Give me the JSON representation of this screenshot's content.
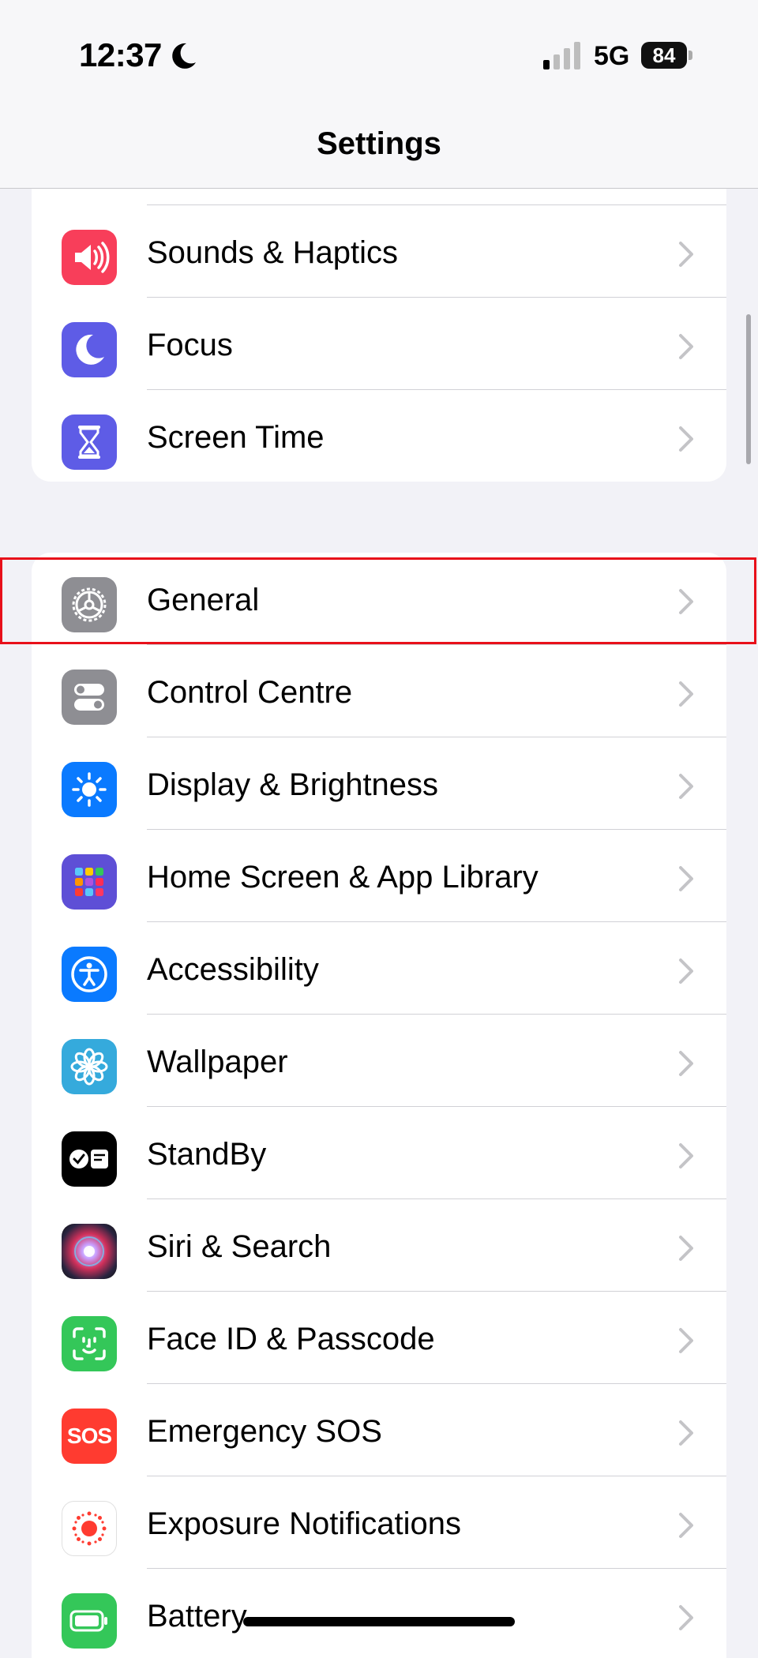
{
  "status": {
    "time": "12:37",
    "network": "5G",
    "battery": "84"
  },
  "nav": {
    "title": "Settings"
  },
  "colors": {
    "sounds": "#f83e5a",
    "focus": "#5e5ce6",
    "screentime": "#5e5ce6",
    "general": "#8e8e93",
    "control": "#8e8e93",
    "display": "#0a7aff",
    "home": "#5e4fd6",
    "accessibility": "#0a7aff",
    "wallpaper": "#35aadc",
    "standby": "#000000",
    "faceid": "#34c759",
    "sos": "#ff3b30",
    "battery": "#34c759",
    "highlight": "#e8101a"
  },
  "groups": [
    {
      "items": [
        {
          "label": "Sounds & Haptics",
          "icon": "speaker-icon"
        },
        {
          "label": "Focus",
          "icon": "moon-icon"
        },
        {
          "label": "Screen Time",
          "icon": "hourglass-icon"
        }
      ]
    },
    {
      "items": [
        {
          "label": "General",
          "icon": "gear-icon"
        },
        {
          "label": "Control Centre",
          "icon": "toggles-icon"
        },
        {
          "label": "Display & Brightness",
          "icon": "sun-icon"
        },
        {
          "label": "Home Screen & App Library",
          "icon": "app-grid-icon"
        },
        {
          "label": "Accessibility",
          "icon": "accessibility-icon"
        },
        {
          "label": "Wallpaper",
          "icon": "flower-icon"
        },
        {
          "label": "StandBy",
          "icon": "standby-icon"
        },
        {
          "label": "Siri & Search",
          "icon": "siri-icon"
        },
        {
          "label": "Face ID & Passcode",
          "icon": "faceid-icon"
        },
        {
          "label": "Emergency SOS",
          "icon": "sos-icon",
          "icon_text": "SOS"
        },
        {
          "label": "Exposure Notifications",
          "icon": "exposure-icon"
        },
        {
          "label": "Battery",
          "icon": "battery-icon"
        }
      ]
    }
  ]
}
